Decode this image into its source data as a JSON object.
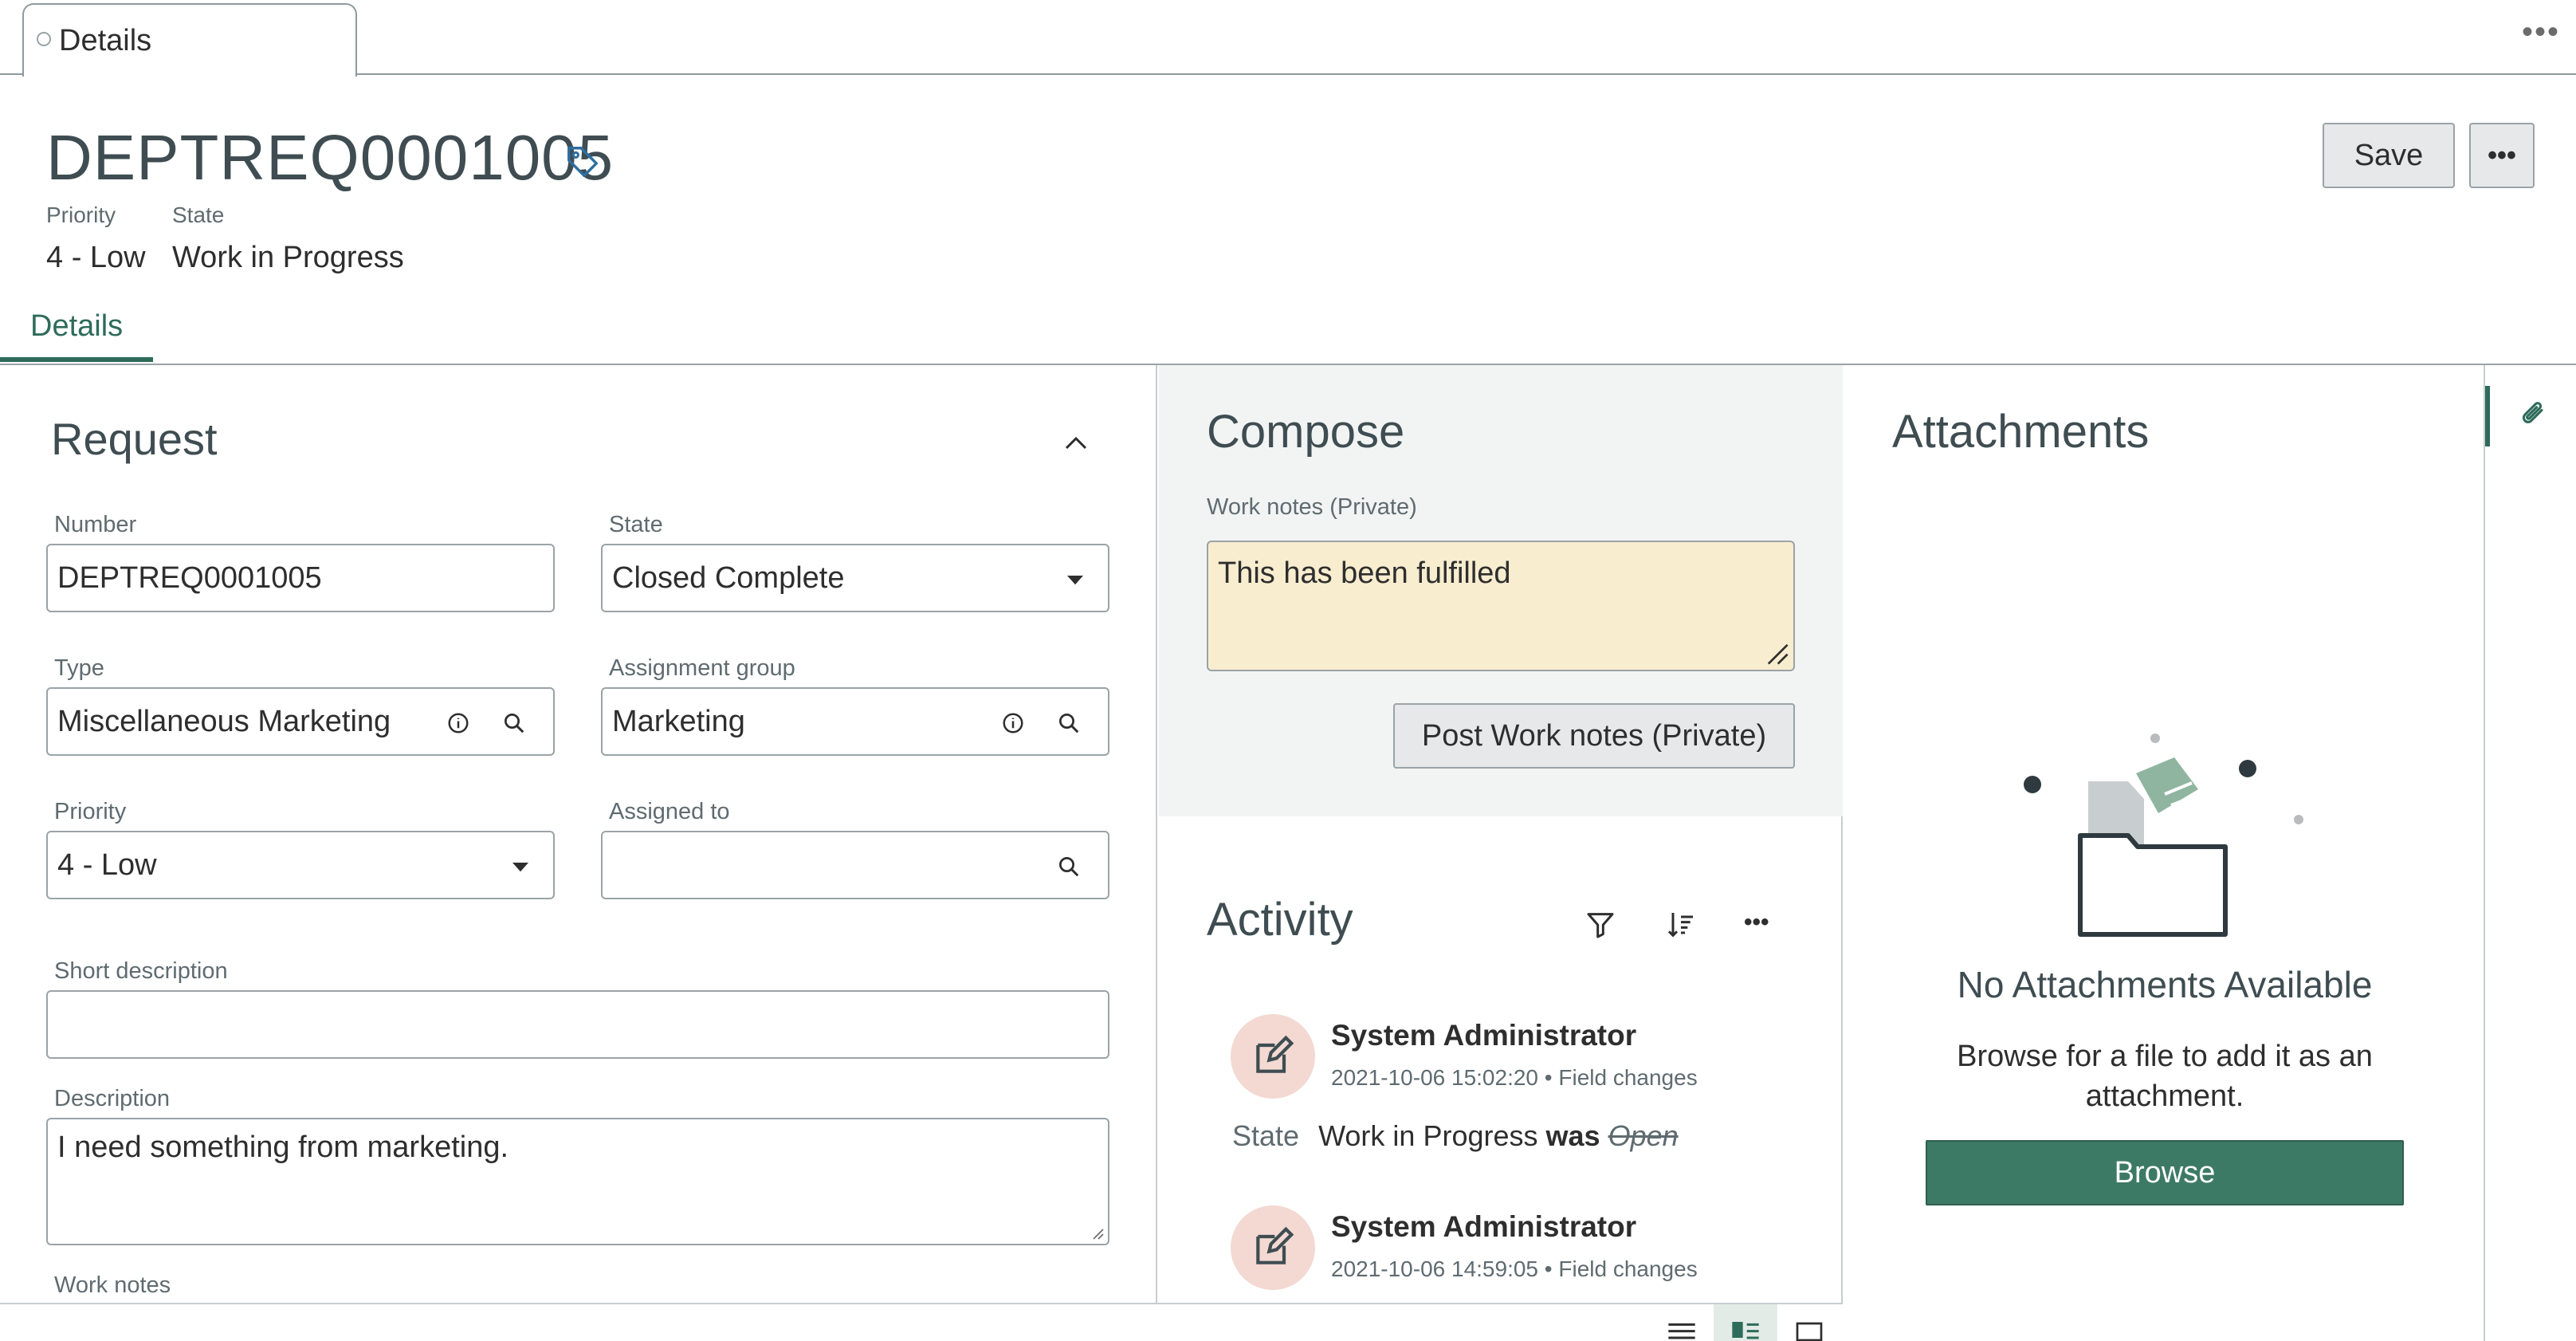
{
  "tabs": {
    "details_label": "Details"
  },
  "header": {
    "record_number": "DEPTREQ0001005",
    "priority_label": "Priority",
    "priority_value": "4 - Low",
    "state_label": "State",
    "state_value": "Work in Progress",
    "save_label": "Save"
  },
  "subtabs": {
    "details_label": "Details"
  },
  "request": {
    "section_title": "Request",
    "number": {
      "label": "Number",
      "value": "DEPTREQ0001005"
    },
    "state": {
      "label": "State",
      "value": "Closed Complete"
    },
    "type": {
      "label": "Type",
      "value": "Miscellaneous Marketing"
    },
    "assignment_group": {
      "label": "Assignment group",
      "value": "Marketing"
    },
    "priority": {
      "label": "Priority",
      "value": "4 - Low"
    },
    "assigned_to": {
      "label": "Assigned to",
      "value": ""
    },
    "short_description": {
      "label": "Short description",
      "value": ""
    },
    "description": {
      "label": "Description",
      "value": "I need something from marketing."
    },
    "work_notes": {
      "label": "Work notes"
    }
  },
  "compose": {
    "title": "Compose",
    "work_notes_label": "Work notes (Private)",
    "work_notes_value": "This has been fulfilled",
    "post_label": "Post Work notes (Private)"
  },
  "activity": {
    "title": "Activity",
    "items": [
      {
        "author": "System Administrator",
        "timestamp": "2021-10-06 15:02:20",
        "kind": "Field changes",
        "field": "State",
        "new_value": "Work in Progress",
        "was": "was",
        "old_value": "Open"
      },
      {
        "author": "System Administrator",
        "timestamp": "2021-10-06 14:59:05",
        "kind": "Field changes"
      }
    ]
  },
  "attachments": {
    "title": "Attachments",
    "empty_title": "No Attachments Available",
    "empty_help": "Browse for a file to add it as an attachment.",
    "browse_label": "Browse"
  },
  "colors": {
    "accent": "#2e6b5a",
    "browse_button": "#3d7a66",
    "compose_bg": "#f2f4f3",
    "work_notes_bg": "#f8edcf",
    "avatar_bg": "#f3d9d2"
  },
  "icons": [
    "tag-icon",
    "more-icon",
    "chevron-up-icon",
    "info-icon",
    "search-icon",
    "caret-down-icon",
    "filter-icon",
    "sort-icon",
    "edit-icon",
    "paperclip-icon",
    "list-view-icon",
    "split-view-icon",
    "single-view-icon",
    "folder-illustration"
  ]
}
